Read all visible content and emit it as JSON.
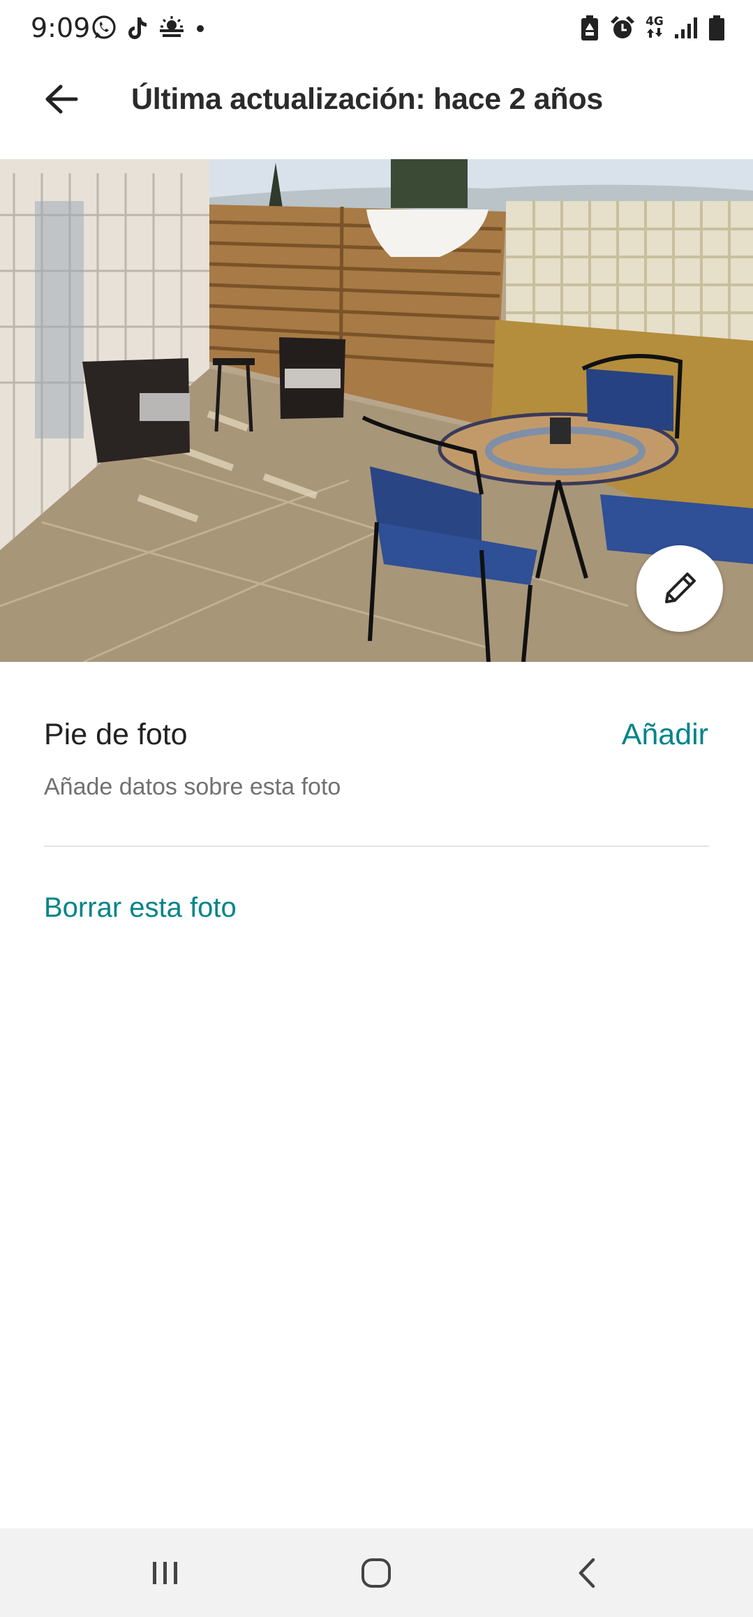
{
  "status_bar": {
    "time": "9:09",
    "left_icons": [
      "whatsapp-icon",
      "tiktok-icon",
      "weather-icon",
      "dot-icon"
    ],
    "right_icons": [
      "battery-saver-icon",
      "alarm-icon",
      "network-4g-icon",
      "signal-icon",
      "battery-icon"
    ],
    "network_label": "4G"
  },
  "header": {
    "back_icon": "arrow-left-icon",
    "title": "Última actualización: hace 2 años"
  },
  "photo": {
    "description_icon": "patio-photo",
    "edit_icon": "pencil-icon"
  },
  "caption": {
    "title": "Pie de foto",
    "add_label": "Añadir",
    "hint": "Añade datos sobre esta foto"
  },
  "actions": {
    "delete_label": "Borrar esta foto"
  },
  "colors": {
    "accent": "#008489",
    "text_primary": "#222222",
    "text_secondary": "#717171",
    "divider": "#e4e4e4",
    "nav_background": "#f2f2f2"
  },
  "nav_bar": {
    "recents_icon": "recents-icon",
    "home_icon": "home-icon",
    "back_icon": "nav-back-icon"
  }
}
